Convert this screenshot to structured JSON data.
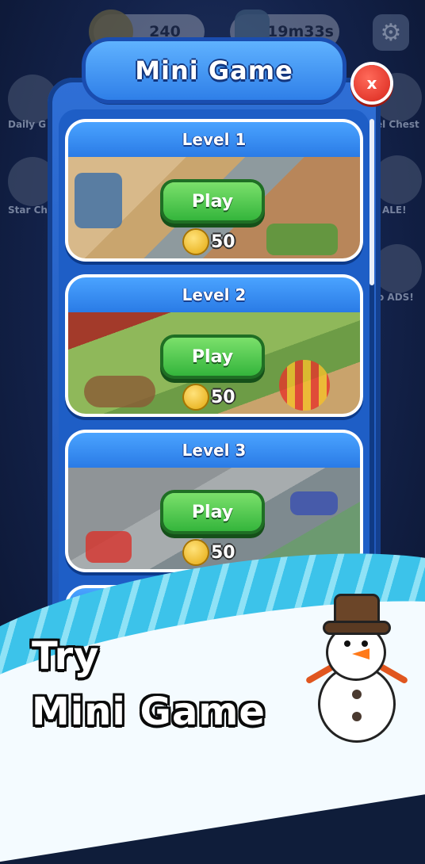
{
  "hud": {
    "coins": "240",
    "timer": "19m33s"
  },
  "side_labels": {
    "left_top": "Daily G",
    "left_bottom": "Star Ch",
    "right_top": "el Chest",
    "right_mid": "ALE!",
    "right_bottom": "o ADS!"
  },
  "dialog": {
    "title": "Mini Game",
    "close_label": "x"
  },
  "levels": [
    {
      "title": "Level 1",
      "play_label": "Play",
      "cost": "50"
    },
    {
      "title": "Level 2",
      "play_label": "Play",
      "cost": "50"
    },
    {
      "title": "Level 3",
      "play_label": "Play",
      "cost": "50"
    }
  ],
  "promo": {
    "line1": "Try",
    "line2": "Mini Game"
  },
  "colors": {
    "panel_blue": "#1f56b8",
    "play_green": "#34b53c",
    "close_red": "#d9261c",
    "coin_gold": "#e5a90e"
  },
  "icons": [
    "coin-icon",
    "timer-icon",
    "gear-icon",
    "close-icon",
    "snowman-icon"
  ]
}
